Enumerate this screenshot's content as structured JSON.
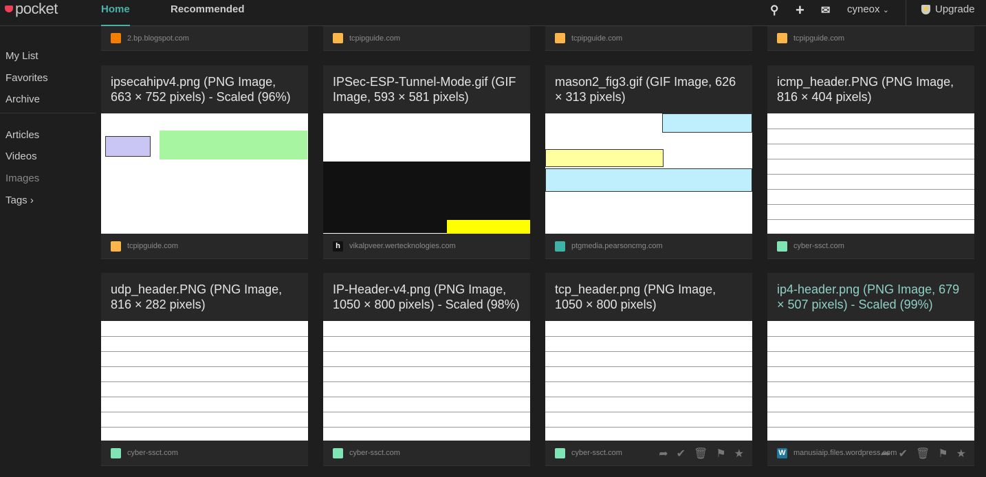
{
  "header": {
    "logo": "pocket",
    "tabs": [
      {
        "label": "Home",
        "active": true
      },
      {
        "label": "Recommended",
        "active": false
      }
    ],
    "icons": [
      "search-icon",
      "plus-icon",
      "mail-icon"
    ],
    "user": "cyneox",
    "upgrade": "Upgrade",
    "accent": "#4ab3a8"
  },
  "sidebar": {
    "items": [
      {
        "label": "My List"
      },
      {
        "label": "Favorites"
      },
      {
        "label": "Archive"
      },
      {
        "label": "Articles"
      },
      {
        "label": "Videos"
      },
      {
        "label": "Images"
      },
      {
        "label": "Tags"
      }
    ]
  },
  "top_row": [
    {
      "source": "2.bp.blogspot.com",
      "favicon_color": "#f57d00"
    },
    {
      "source": "tcpipguide.com",
      "favicon_color": "#fbb548"
    },
    {
      "source": "tcpipguide.com",
      "favicon_color": "#fbb548"
    },
    {
      "source": "tcpipguide.com",
      "favicon_color": "#fbb548"
    }
  ],
  "cards": [
    {
      "title": "ipsecahipv4.png (PNG Image, 663 × 752 pixels) - Scaled (96%)",
      "source": "tcpipguide.com",
      "favicon_color": "#fbb548"
    },
    {
      "title": "IPSec-ESP-Tunnel-Mode.gif (GIF Image, 593 × 581 pixels)",
      "source": "vikalpveer.wertecknologies.com",
      "favicon_color": "#111111",
      "favicon_letter": "h"
    },
    {
      "title": "mason2_fig3.gif (GIF Image, 626 × 313 pixels)",
      "source": "ptgmedia.pearsoncmg.com",
      "favicon_color": "#3fb2a8"
    },
    {
      "title": "icmp_header.PNG (PNG Image, 816 × 404 pixels)",
      "source": "cyber-ssct.com",
      "favicon_color": "#7fe5b5"
    },
    {
      "title": "udp_header.PNG (PNG Image, 816 × 282 pixels)",
      "source": "cyber-ssct.com",
      "favicon_color": "#7fe5b5"
    },
    {
      "title": "IP-Header-v4.png (PNG Image, 1050 × 800 pixels) - Scaled (98%)",
      "source": "cyber-ssct.com",
      "favicon_color": "#7fe5b5"
    },
    {
      "title": "tcp_header.png (PNG Image, 1050 × 800 pixels)",
      "source": "cyber-ssct.com",
      "favicon_color": "#7fe5b5",
      "actions": [
        "share-icon",
        "check-icon",
        "trash-icon",
        "tag-icon",
        "star-icon"
      ]
    },
    {
      "title": "ip4-header.png (PNG Image, 679 × 507 pixels) - Scaled (99%)",
      "source": "manusiaip.files.wordpress.com",
      "favicon_color": "#21759b",
      "favicon_letter": "W",
      "highlighted": true,
      "actions": [
        "share-icon",
        "check-icon",
        "trash-icon",
        "tag-icon",
        "star-icon"
      ]
    }
  ]
}
